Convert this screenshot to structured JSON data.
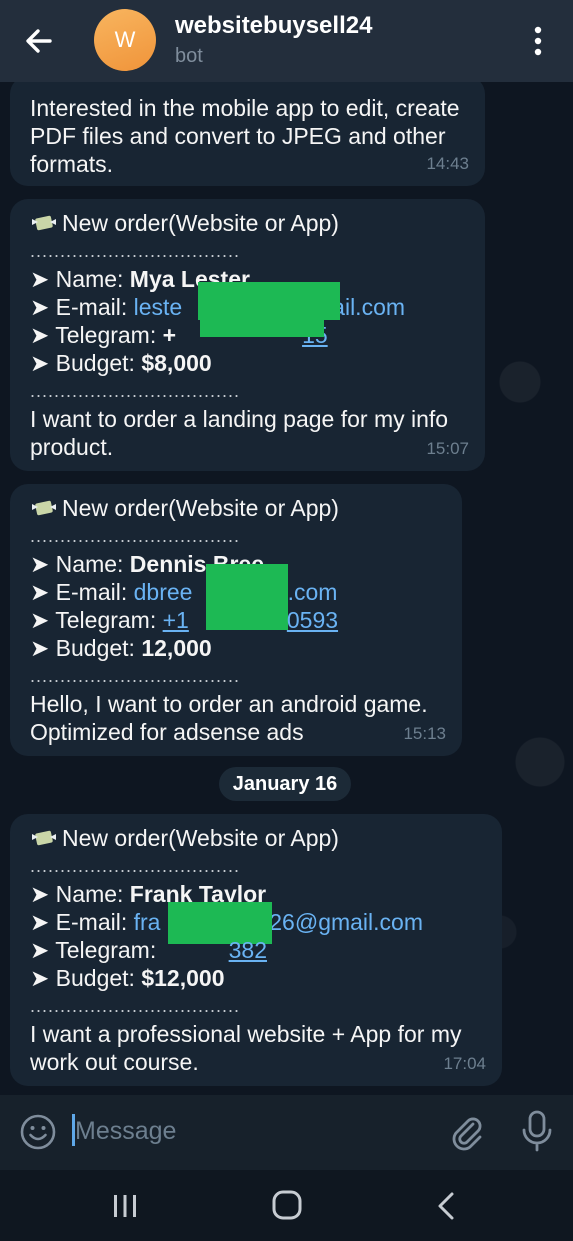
{
  "header": {
    "avatar_letter": "W",
    "title": "websitebuysell24",
    "subtitle": "bot"
  },
  "messages": [
    {
      "text_lines": [
        "Interested in the mobile app to edit, create",
        "PDF files and convert to JPEG and other",
        "formats."
      ],
      "time": "14:43"
    },
    {
      "heading": "New order(Website or App)",
      "divider": "...................................",
      "name_label": "➤ Name: ",
      "name": "Mya Lester",
      "email_label": "➤ E-mail: ",
      "email_start": "leste",
      "email_end": "gmail.com",
      "telegram_label": "➤ Telegram: ",
      "telegram_start": "+",
      "telegram_end": "15",
      "budget_label": "➤ Budget: ",
      "budget": "$8,000",
      "body_lines": [
        "I want to order a landing page for my info",
        "product."
      ],
      "time": "15:07"
    },
    {
      "heading": "New order(Website or App)",
      "divider": "...................................",
      "name_label": "➤ Name: ",
      "name": "Dennis Bree",
      "email_label": "➤ E-mail: ",
      "email_start": "dbree",
      "email_end": "l.com",
      "telegram_label": "➤ Telegram: ",
      "telegram_start": "+1",
      "telegram_end": "0593",
      "budget_label": "➤ Budget: ",
      "budget": "12,000",
      "body_lines": [
        "Hello, I want to order an android game.",
        "Optimized for adsense ads"
      ],
      "time": "15:13"
    },
    {
      "heading": "New order(Website or App)",
      "divider": "...................................",
      "name_label": "➤ Name: ",
      "name": "Frank Taylor",
      "email_label": "➤ E-mail: ",
      "email_start": "fra",
      "email_end": "426@gmail.com",
      "telegram_label": "➤ Telegram: ",
      "telegram_start": "",
      "telegram_end": "382",
      "budget_label": "➤ Budget: ",
      "budget": "$12,000",
      "body_lines": [
        "I want a professional website + App for my",
        "work out course."
      ],
      "time": "17:04"
    }
  ],
  "date_separator": "January 16",
  "input": {
    "placeholder": "Message"
  },
  "colors": {
    "header_bg": "#232e3c",
    "chat_bg": "#0e1621",
    "bubble_bg": "#182533",
    "link": "#6ab3f3",
    "redaction": "#1db954",
    "avatar": "#f4a24a"
  },
  "icons": [
    "back-arrow-icon",
    "more-vert-icon",
    "money-wings-icon",
    "emoji-icon",
    "attach-icon",
    "mic-icon",
    "nav-recent-icon",
    "nav-home-icon",
    "nav-back-icon"
  ]
}
